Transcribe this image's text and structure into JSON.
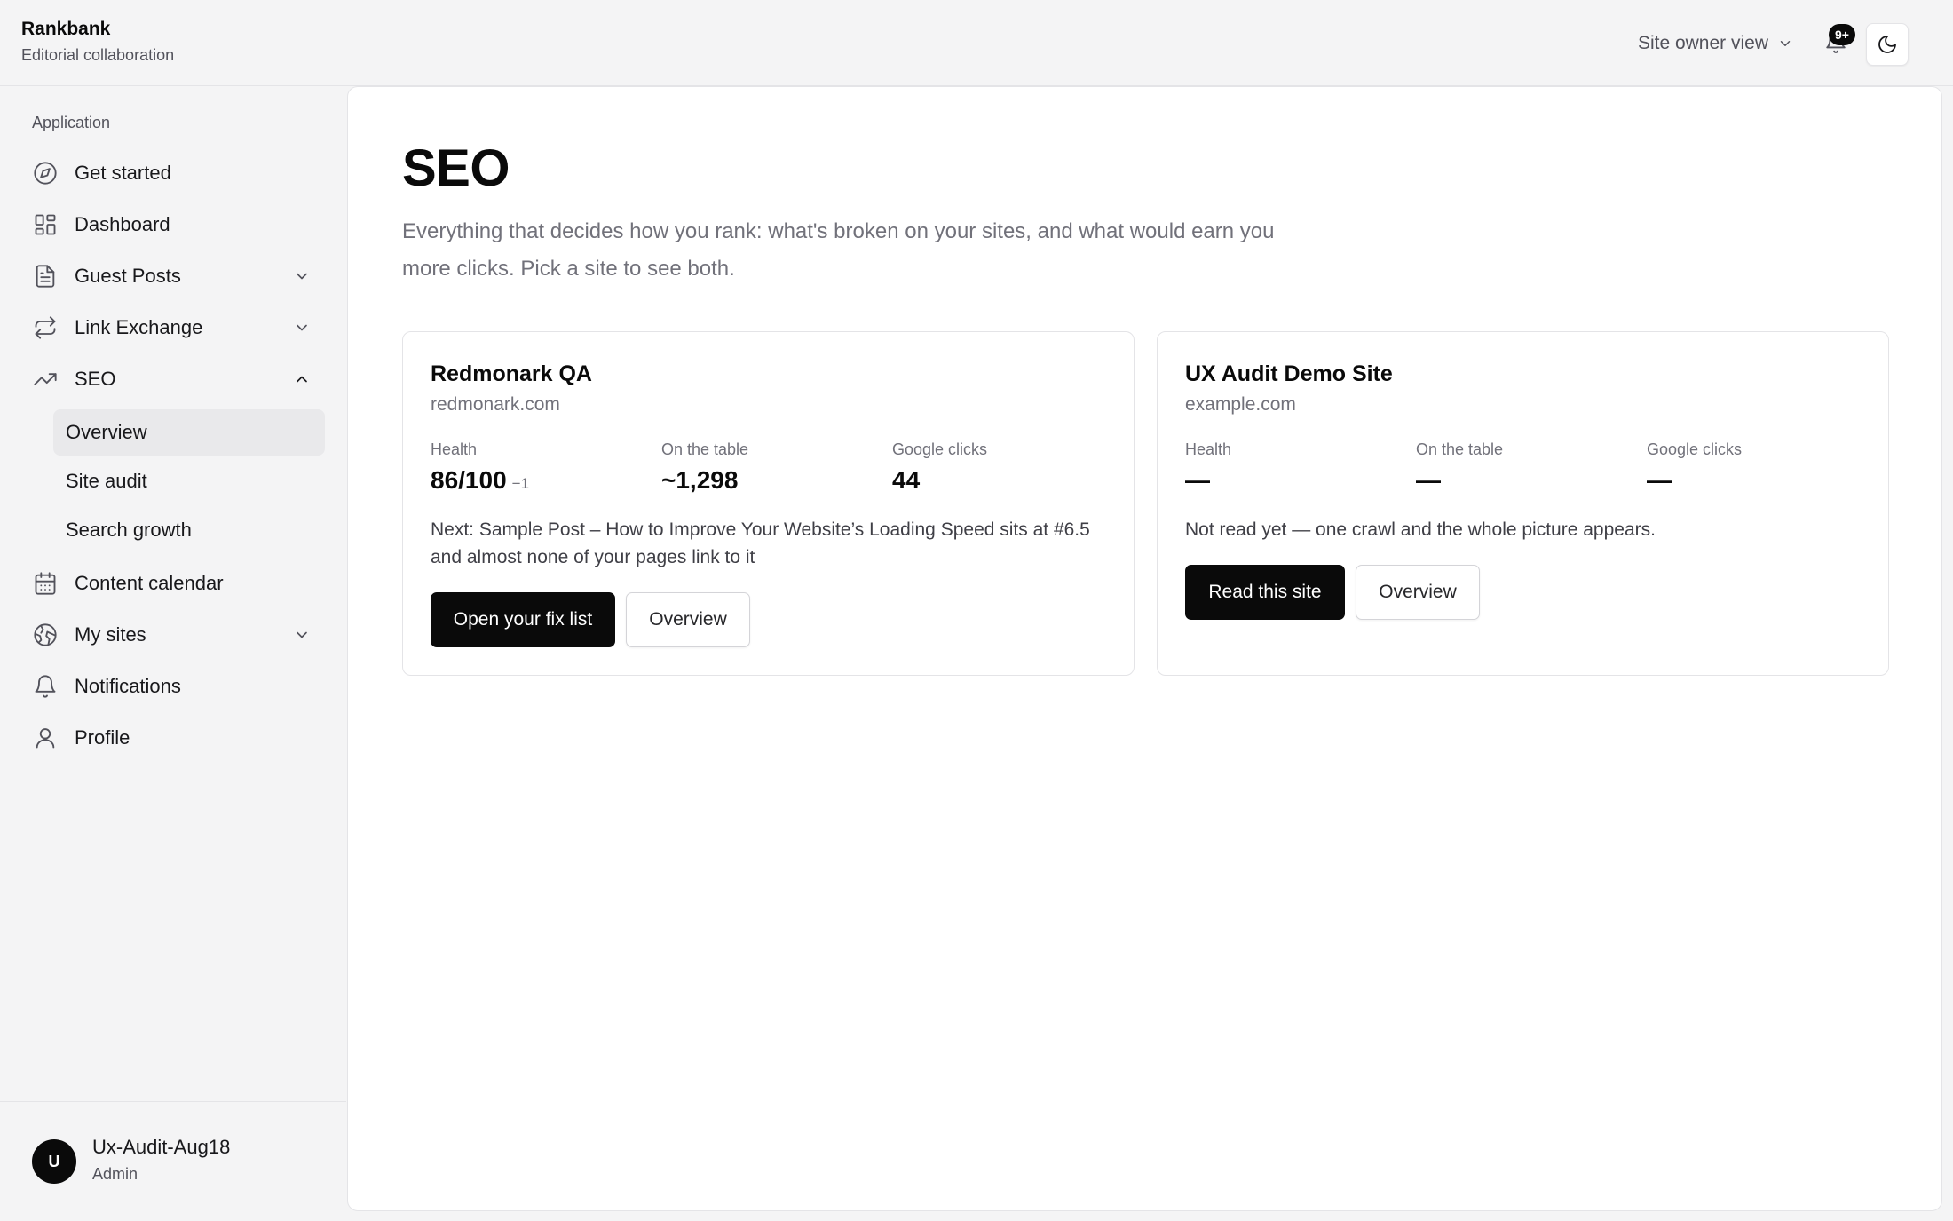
{
  "app": {
    "name": "Rankbank",
    "subtitle": "Editorial collaboration"
  },
  "header": {
    "view_label": "Site owner view",
    "notifications_badge": "9+"
  },
  "sidebar": {
    "section_label": "Application",
    "items": [
      {
        "label": "Get started",
        "icon": "compass-icon"
      },
      {
        "label": "Dashboard",
        "icon": "dashboard-icon"
      },
      {
        "label": "Guest Posts",
        "icon": "document-icon",
        "expandable": true
      },
      {
        "label": "Link Exchange",
        "icon": "repeat-icon",
        "expandable": true
      },
      {
        "label": "SEO",
        "icon": "trending-up-icon",
        "expanded": true
      },
      {
        "label": "Content calendar",
        "icon": "calendar-icon"
      },
      {
        "label": "My sites",
        "icon": "globe-icon",
        "expandable": true
      },
      {
        "label": "Notifications",
        "icon": "bell-icon"
      },
      {
        "label": "Profile",
        "icon": "user-icon"
      }
    ],
    "seo_subitems": [
      {
        "label": "Overview",
        "active": true
      },
      {
        "label": "Site audit"
      },
      {
        "label": "Search growth"
      }
    ],
    "user": {
      "initial": "U",
      "name": "Ux-Audit-Aug18",
      "role": "Admin"
    }
  },
  "main": {
    "title": "SEO",
    "description": "Everything that decides how you rank: what's broken on your sites, and what would earn you more clicks. Pick a site to see both.",
    "sites": [
      {
        "name": "Redmonark QA",
        "domain": "redmonark.com",
        "health_label": "Health",
        "health_value": "86/100",
        "health_delta": "−1",
        "table_label": "On the table",
        "table_value": "~1,298",
        "clicks_label": "Google clicks",
        "clicks_value": "44",
        "next": "Next: Sample Post – How to Improve Your Website’s Loading Speed sits at #6.5 and almost none of your pages link to it",
        "primary_button": "Open your fix list",
        "secondary_button": "Overview"
      },
      {
        "name": "UX Audit Demo Site",
        "domain": "example.com",
        "health_label": "Health",
        "health_value": "—",
        "table_label": "On the table",
        "table_value": "—",
        "clicks_label": "Google clicks",
        "clicks_value": "—",
        "next": "Not read yet — one crawl and the whole picture appears.",
        "primary_button": "Read this site",
        "secondary_button": "Overview"
      }
    ]
  },
  "colors": {
    "background": "#f4f4f5",
    "panel": "#ffffff",
    "primary": "#0a0a0a",
    "muted_text": "#71717a",
    "border": "#e4e4e7"
  }
}
